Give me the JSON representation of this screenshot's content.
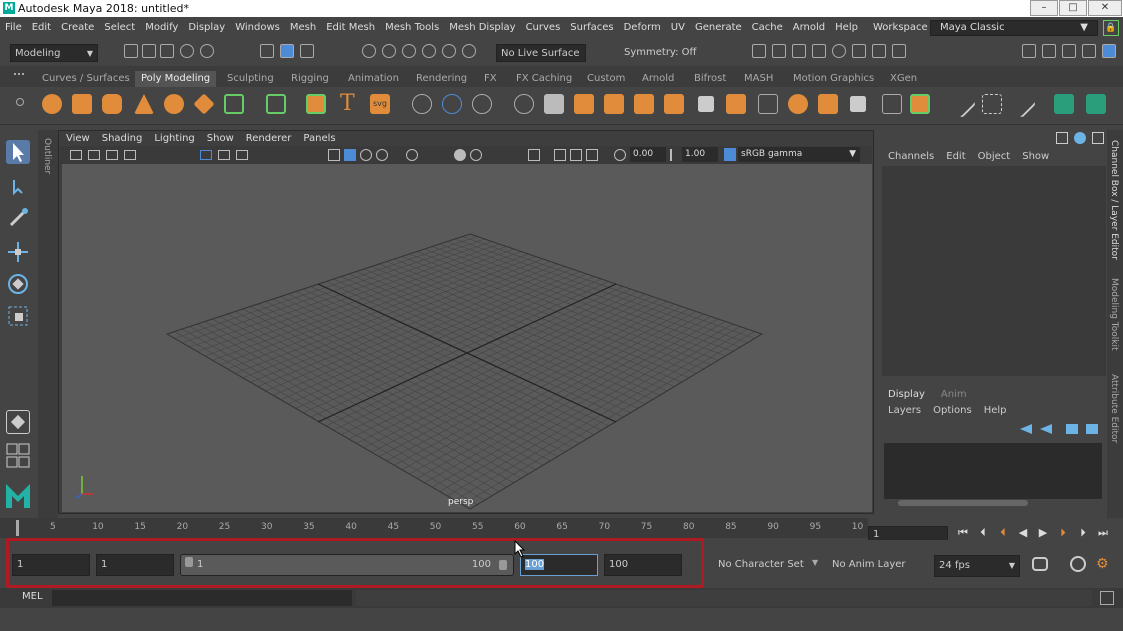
{
  "window": {
    "title": "Autodesk Maya 2018: untitled*"
  },
  "menus": [
    "File",
    "Edit",
    "Create",
    "Select",
    "Modify",
    "Display",
    "Windows",
    "Mesh",
    "Edit Mesh",
    "Mesh Tools",
    "Mesh Display",
    "Curves",
    "Surfaces",
    "Deform",
    "UV",
    "Generate",
    "Cache",
    "Arnold",
    "Help"
  ],
  "workspace": {
    "label": "Workspace :",
    "value": "Maya Classic"
  },
  "toolbar": {
    "mode": "Modeling",
    "live_surface": "No Live Surface",
    "symmetry": "Symmetry: Off"
  },
  "shelf_tabs": [
    "Curves / Surfaces",
    "Poly Modeling",
    "Sculpting",
    "Rigging",
    "Animation",
    "Rendering",
    "FX",
    "FX Caching",
    "Custom",
    "Arnold",
    "Bifrost",
    "MASH",
    "Motion Graphics",
    "XGen"
  ],
  "shelf_active": "Poly Modeling",
  "panel_menu": [
    "View",
    "Shading",
    "Lighting",
    "Show",
    "Renderer",
    "Panels"
  ],
  "panel_tools": {
    "exposure": "0.00",
    "gamma": "1.00",
    "colorspace": "sRGB gamma"
  },
  "viewport": {
    "camera": "persp"
  },
  "outliner_label": "Outliner",
  "channel_box": {
    "menus": [
      "Channels",
      "Edit",
      "Object",
      "Show"
    ]
  },
  "layer_editor": {
    "tabs": [
      "Display",
      "Anim"
    ],
    "menus": [
      "Layers",
      "Options",
      "Help"
    ]
  },
  "side_tabs": [
    "Channel Box / Layer Editor",
    "Modeling Toolkit",
    "Attribute Editor"
  ],
  "timeline": {
    "ticks": [
      "5",
      "10",
      "15",
      "20",
      "25",
      "30",
      "35",
      "40",
      "45",
      "50",
      "55",
      "60",
      "65",
      "70",
      "75",
      "80",
      "85",
      "90",
      "95",
      "10"
    ],
    "current_frame": "1"
  },
  "range": {
    "start": "1",
    "playback_start": "1",
    "slider_start": "1",
    "slider_end": "100",
    "playback_end": "100",
    "end": "100"
  },
  "character_set": "No Character Set",
  "anim_layer": "No Anim Layer",
  "fps": "24 fps",
  "cmdline_label": "MEL",
  "colors": {
    "highlight": "#b01a22",
    "accent": "#4d8bd6",
    "shelf_icon": "#e08c3a"
  }
}
